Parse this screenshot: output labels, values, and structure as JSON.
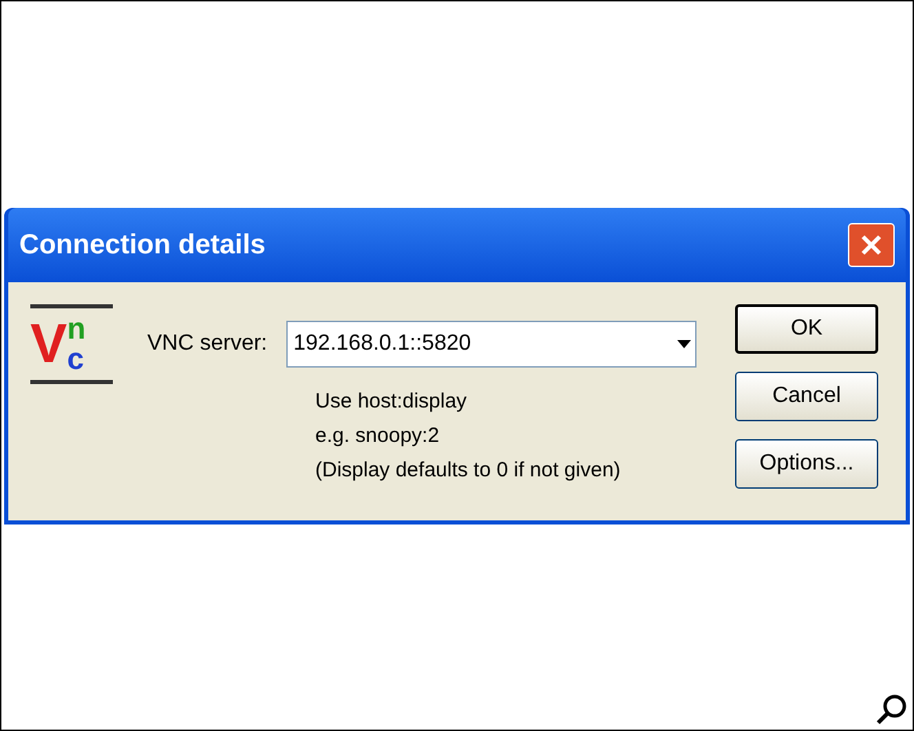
{
  "window": {
    "title": "Connection details"
  },
  "logo": {
    "letters": [
      "V",
      "n",
      "c"
    ]
  },
  "server_field": {
    "label": "VNC server:",
    "value": "192.168.0.1::5820"
  },
  "hints": [
    "Use host:display",
    "e.g. snoopy:2",
    "(Display defaults to 0 if not given)"
  ],
  "buttons": [
    {
      "label": "OK",
      "default": true
    },
    {
      "label": "Cancel",
      "default": false
    },
    {
      "label": "Options...",
      "default": false
    }
  ]
}
